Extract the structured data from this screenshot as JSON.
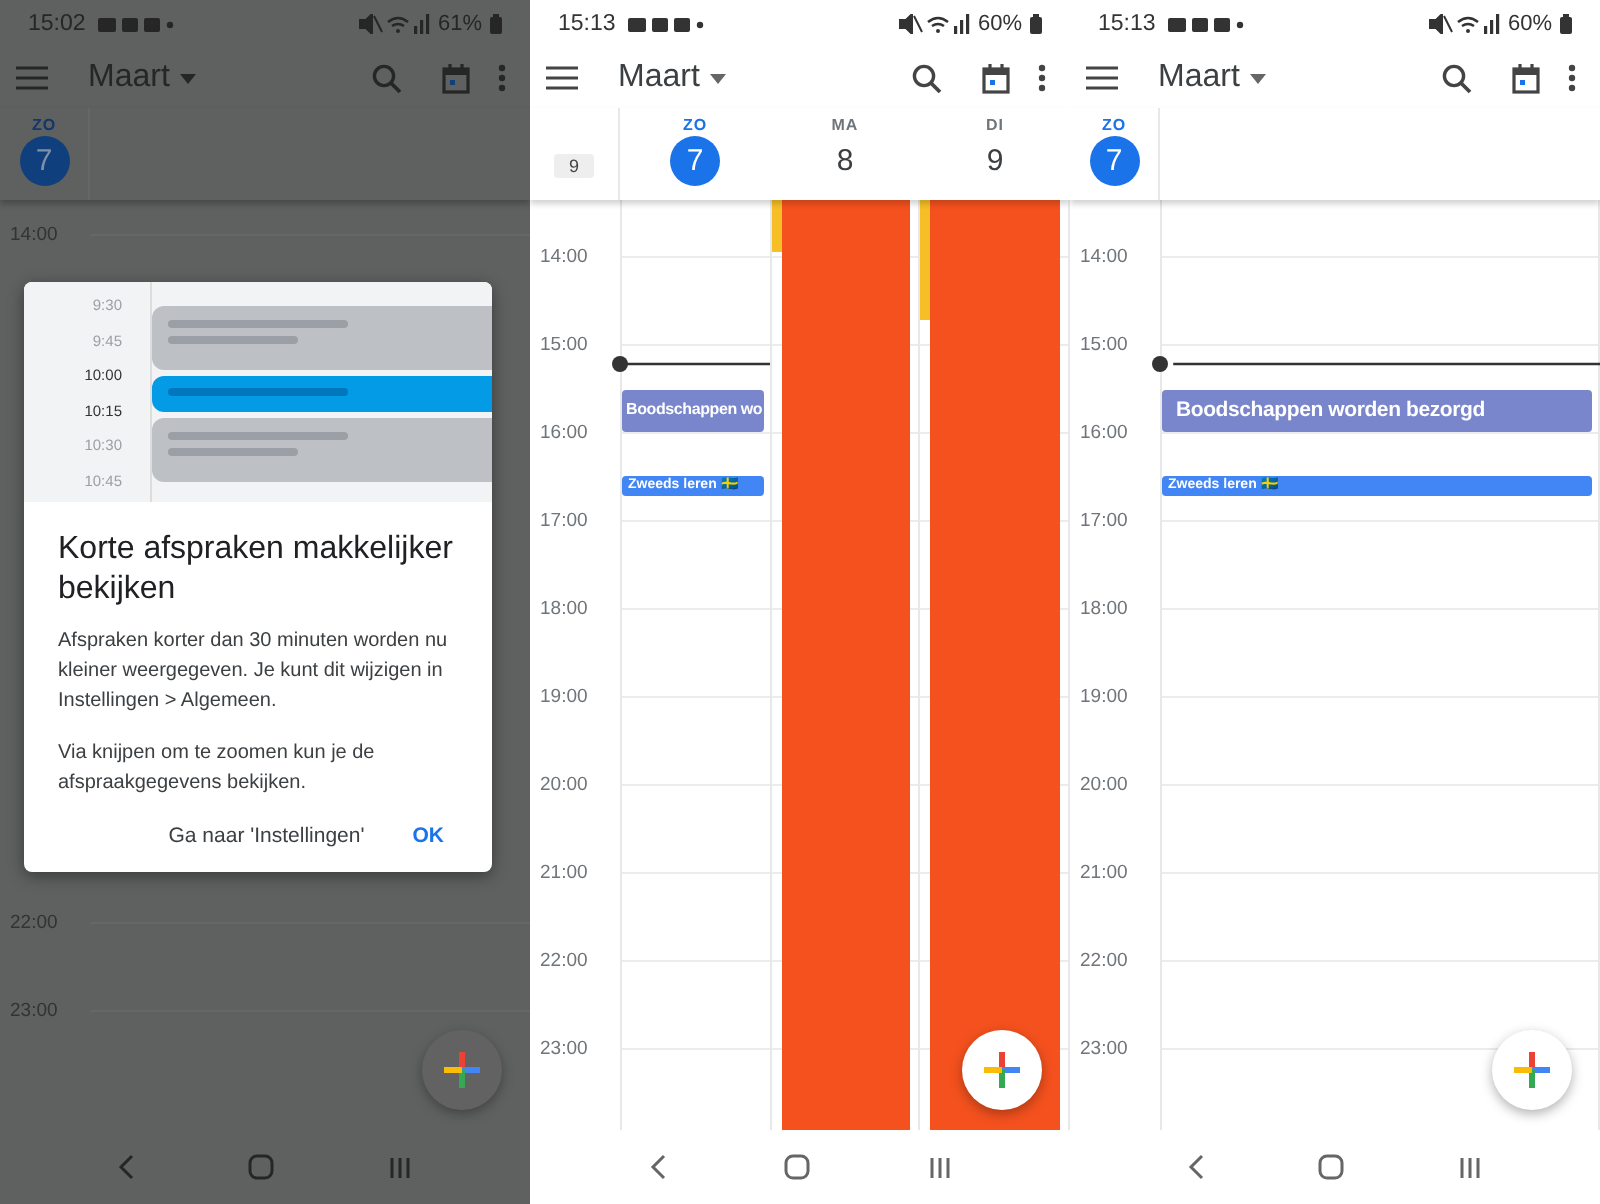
{
  "panels": [
    {
      "dimmed": true,
      "status_bar": {
        "time": "15:02",
        "battery": "61%"
      },
      "toolbar": {
        "title": "Maart"
      },
      "days": [
        {
          "weekday": "ZO",
          "date": "7",
          "selected": true
        }
      ],
      "hours": [
        "14:00",
        "22:00",
        "23:00"
      ],
      "dialog": {
        "times": [
          {
            "label": "9:30",
            "highlighted": false
          },
          {
            "label": "9:45",
            "highlighted": false
          },
          {
            "label": "10:00",
            "highlighted": true
          },
          {
            "label": "10:15",
            "highlighted": true
          },
          {
            "label": "10:30",
            "highlighted": false
          },
          {
            "label": "10:45",
            "highlighted": false
          }
        ],
        "title": "Korte afspraken makkelijker bekijken",
        "paragraphs": [
          "Afspraken korter dan 30 minuten worden nu kleiner weergegeven. Je kunt dit wijzigen in Instellingen > Algemeen.",
          "Via knijpen om te zoomen kun je de afspraakgegevens bekijken."
        ],
        "buttons": [
          "Ga naar 'Instellingen'",
          "OK"
        ]
      }
    },
    {
      "dimmed": false,
      "status_bar": {
        "time": "15:13",
        "battery": "60%"
      },
      "toolbar": {
        "title": "Maart"
      },
      "week_number": "9",
      "days": [
        {
          "weekday": "ZO",
          "date": "7",
          "selected": true,
          "events": [
            {
              "kind": "timed",
              "title": "Boodschappen wo",
              "color": "#7986cb"
            },
            {
              "kind": "short",
              "title": "Zweeds leren 🇸🇪",
              "color": "#4285f4"
            }
          ]
        },
        {
          "weekday": "MA",
          "date": "8",
          "selected": false,
          "events": [
            {
              "kind": "marker",
              "color": "#f6bf26"
            },
            {
              "kind": "block",
              "color": "#f4511e"
            }
          ]
        },
        {
          "weekday": "DI",
          "date": "9",
          "selected": false,
          "events": [
            {
              "kind": "marker",
              "color": "#f6bf26"
            },
            {
              "kind": "block",
              "color": "#f4511e"
            }
          ]
        }
      ],
      "hours": [
        "14:00",
        "15:00",
        "16:00",
        "17:00",
        "18:00",
        "19:00",
        "20:00",
        "21:00",
        "22:00",
        "23:00"
      ],
      "now_line": true
    },
    {
      "dimmed": false,
      "status_bar": {
        "time": "15:13",
        "battery": "60%"
      },
      "toolbar": {
        "title": "Maart"
      },
      "days": [
        {
          "weekday": "ZO",
          "date": "7",
          "selected": true,
          "events": [
            {
              "kind": "timed",
              "title": "Boodschappen worden bezorgd",
              "color": "#7986cb"
            },
            {
              "kind": "short",
              "title": "Zweeds leren 🇸🇪",
              "color": "#4285f4"
            }
          ]
        }
      ],
      "hours": [
        "14:00",
        "15:00",
        "16:00",
        "17:00",
        "18:00",
        "19:00",
        "20:00",
        "21:00",
        "22:00",
        "23:00"
      ],
      "now_line": true
    }
  ]
}
